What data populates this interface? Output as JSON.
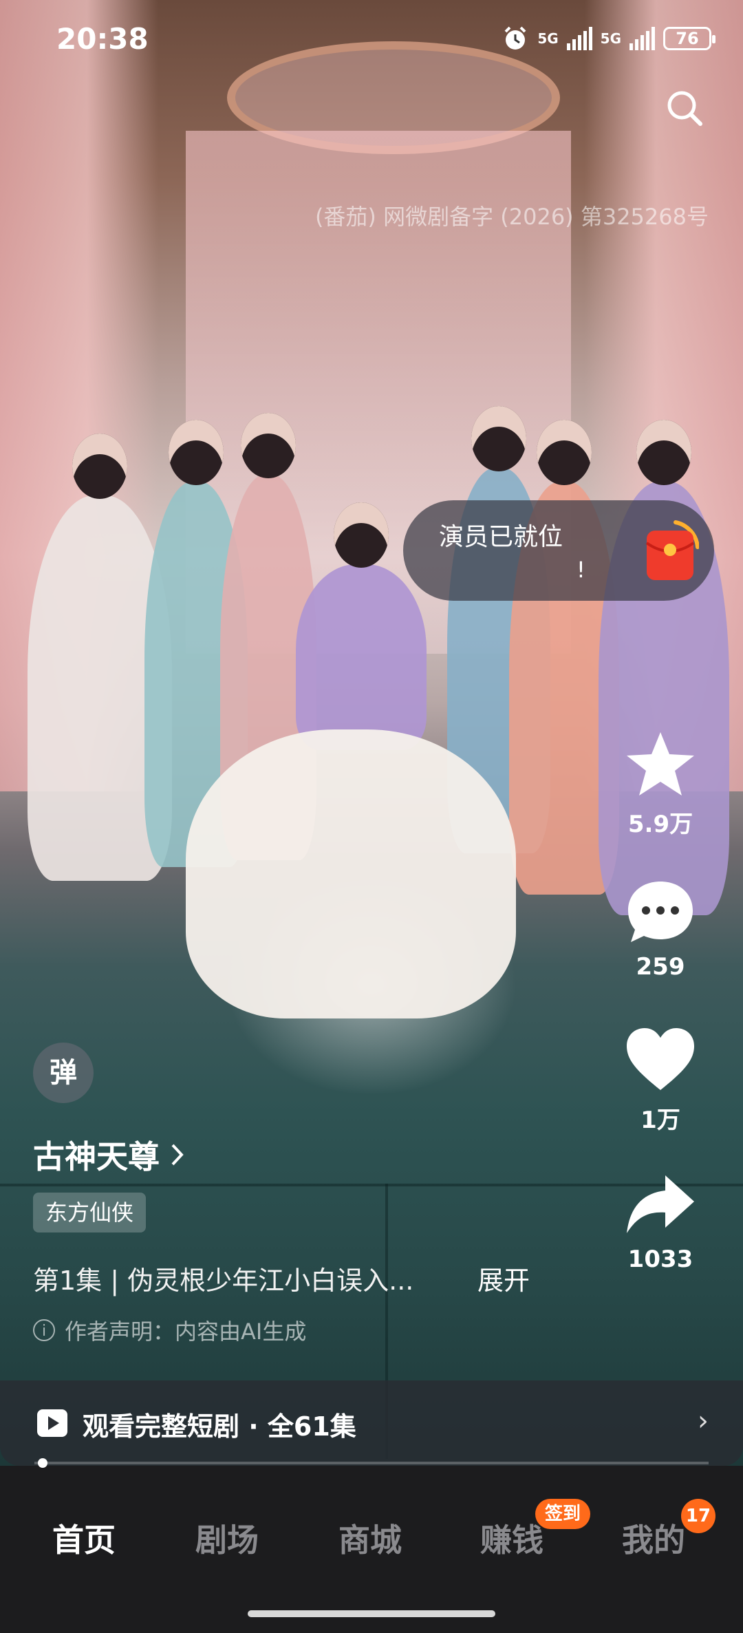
{
  "status_bar": {
    "time": "20:38",
    "network1": "5G",
    "network2": "5G",
    "battery": "76"
  },
  "license_text": "(番茄) 网微剧备字 (2026) 第325268号",
  "promo": {
    "text": "演员已就位",
    "mark": "!"
  },
  "actions": {
    "likes_star": "5.9万",
    "comments": "259",
    "hearts": "1万",
    "shares": "1033"
  },
  "danmu_label": "弹",
  "drama": {
    "title": "古神天尊",
    "genre": "东方仙侠",
    "episode_text": "第1集 | 伪灵根少年江小白误入...",
    "expand_label": "展开",
    "ai_note": "作者声明：内容由AI生成",
    "ai_note_icon": "i"
  },
  "watch_full": {
    "label": "观看完整短剧 · 全61集",
    "chevron": "›"
  },
  "playback_progress": 0.005,
  "nav": {
    "tabs": [
      "首页",
      "剧场",
      "商城",
      "赚钱",
      "我的"
    ],
    "active_index": 0,
    "earn_badge": "签到",
    "me_badge": "17"
  },
  "colors": {
    "badge": "#ff6a1a",
    "nav_bg": "#1c1c1e",
    "redpacket": "#ef3b2c"
  }
}
